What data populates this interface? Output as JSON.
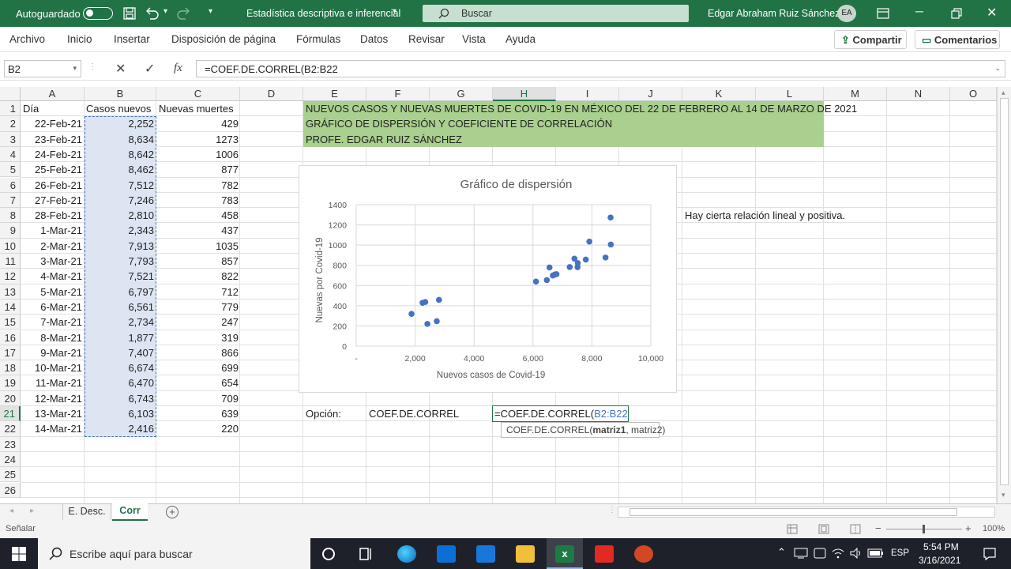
{
  "app": {
    "autosave_label": "Autoguardado",
    "doc_title": "Estadística descriptiva e inferencial",
    "search_placeholder": "Buscar",
    "user_name": "Edgar Abraham Ruiz Sánchez",
    "user_initials": "EA"
  },
  "ribbon": {
    "tabs": [
      "Archivo",
      "Inicio",
      "Insertar",
      "Disposición de página",
      "Fórmulas",
      "Datos",
      "Revisar",
      "Vista",
      "Ayuda"
    ],
    "share_label": "Compartir",
    "comments_label": "Comentarios"
  },
  "formula_bar": {
    "name_box": "B2",
    "fx_symbol": "fx",
    "formula": "=COEF.DE.CORREL(B2:B22"
  },
  "grid": {
    "columns": [
      "A",
      "B",
      "C",
      "D",
      "E",
      "F",
      "G",
      "H",
      "I",
      "J",
      "K",
      "L",
      "M",
      "N",
      "O"
    ],
    "selected_column": "H",
    "selected_row": 21,
    "headers": [
      "Día",
      "Casos nuevos",
      "Nuevas muertes"
    ],
    "rows": [
      [
        "22-Feb-21",
        "2,252",
        "429"
      ],
      [
        "23-Feb-21",
        "8,634",
        "1273"
      ],
      [
        "24-Feb-21",
        "8,642",
        "1006"
      ],
      [
        "25-Feb-21",
        "8,462",
        "877"
      ],
      [
        "26-Feb-21",
        "7,512",
        "782"
      ],
      [
        "27-Feb-21",
        "7,246",
        "783"
      ],
      [
        "28-Feb-21",
        "2,810",
        "458"
      ],
      [
        "1-Mar-21",
        "2,343",
        "437"
      ],
      [
        "2-Mar-21",
        "7,913",
        "1035"
      ],
      [
        "3-Mar-21",
        "7,793",
        "857"
      ],
      [
        "4-Mar-21",
        "7,521",
        "822"
      ],
      [
        "5-Mar-21",
        "6,797",
        "712"
      ],
      [
        "6-Mar-21",
        "6,561",
        "779"
      ],
      [
        "7-Mar-21",
        "2,734",
        "247"
      ],
      [
        "8-Mar-21",
        "1,877",
        "319"
      ],
      [
        "9-Mar-21",
        "7,407",
        "866"
      ],
      [
        "10-Mar-21",
        "6,674",
        "699"
      ],
      [
        "11-Mar-21",
        "6,470",
        "654"
      ],
      [
        "12-Mar-21",
        "6,743",
        "709"
      ],
      [
        "13-Mar-21",
        "6,103",
        "639"
      ],
      [
        "14-Mar-21",
        "2,416",
        "220"
      ]
    ],
    "banner": [
      "NUEVOS CASOS Y NUEVAS MUERTES DE COVID-19 EN MÉXICO DEL 22 DE FEBRERO AL 14 DE MARZO DE 2021",
      "GRÁFICO DE DISPERSIÓN Y COEFICIENTE DE CORRELACIÓN",
      "PROFE. EDGAR RUIZ SÁNCHEZ"
    ],
    "note": "Hay cierta relación lineal y positiva.",
    "option_label": "Opción:",
    "option_value": "COEF.DE.CORREL",
    "editing_prefix": "=COEF.DE.CORREL(",
    "editing_ref": "B2:B22",
    "tooltip_fn": "COEF.DE.CORREL(",
    "tooltip_arg1": "matriz1",
    "tooltip_rest": ", matriz2)"
  },
  "chart_data": {
    "type": "scatter",
    "title": "Gráfico de dispersión",
    "xlabel": "Nuevos casos de Covid-19",
    "ylabel": "Nuevas por Covid-19",
    "xlim": [
      0,
      10000
    ],
    "ylim": [
      0,
      1400
    ],
    "x_ticks": [
      "-",
      "2,000",
      "4,000",
      "6,000",
      "8,000",
      "10,000"
    ],
    "y_ticks": [
      "0",
      "200",
      "400",
      "600",
      "800",
      "1000",
      "1200",
      "1400"
    ],
    "grid": true,
    "color": "#4472c4",
    "points": [
      [
        2252,
        429
      ],
      [
        8634,
        1273
      ],
      [
        8642,
        1006
      ],
      [
        8462,
        877
      ],
      [
        7512,
        782
      ],
      [
        7246,
        783
      ],
      [
        2810,
        458
      ],
      [
        2343,
        437
      ],
      [
        7913,
        1035
      ],
      [
        7793,
        857
      ],
      [
        7521,
        822
      ],
      [
        6797,
        712
      ],
      [
        6561,
        779
      ],
      [
        2734,
        247
      ],
      [
        1877,
        319
      ],
      [
        7407,
        866
      ],
      [
        6674,
        699
      ],
      [
        6470,
        654
      ],
      [
        6743,
        709
      ],
      [
        6103,
        639
      ],
      [
        2416,
        220
      ]
    ]
  },
  "sheets": {
    "tabs": [
      "E. Desc.",
      "Corr"
    ],
    "active": "Corr"
  },
  "status": {
    "mode": "Señalar",
    "zoom": "100%"
  },
  "taskbar": {
    "search_placeholder": "Escribe aquí para buscar",
    "lang": "ESP",
    "time": "5:54 PM",
    "date": "3/16/2021"
  }
}
